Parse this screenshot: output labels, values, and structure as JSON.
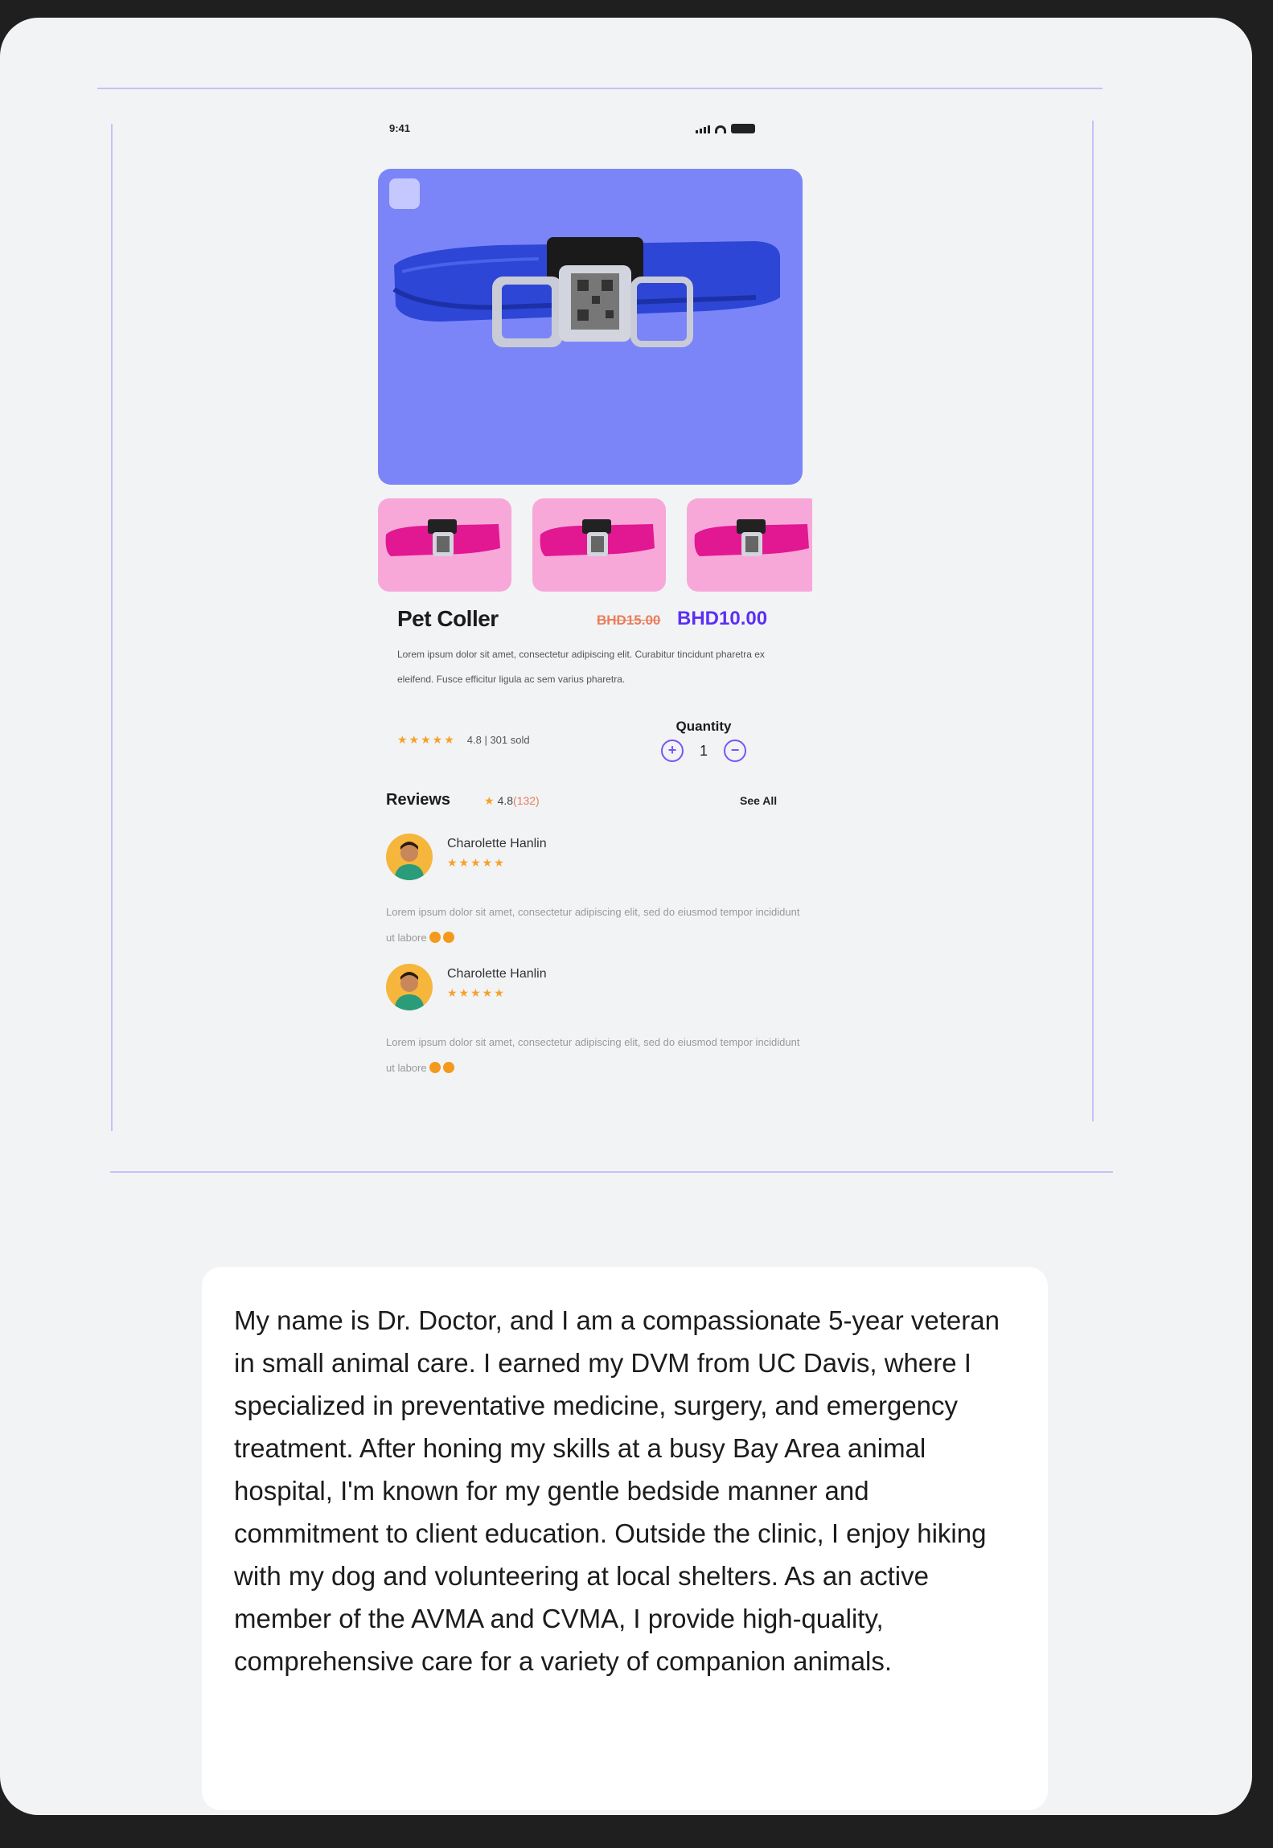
{
  "status_bar": {
    "time": "9:41"
  },
  "product": {
    "title": "Pet Coller",
    "price_old": "BHD15.00",
    "price_new": "BHD10.00",
    "description": "Lorem ipsum dolor sit amet, consectetur adipiscing elit. Curabitur tincidunt pharetra ex eleifend. Fusce efficitur ligula ac sem varius pharetra.",
    "stars": "★★★★★",
    "rating_meta": "4.8 | 301 sold",
    "colors": {
      "hero_bg": "#7b85f8",
      "thumb_bg": "#f7a8d9",
      "accent": "#5b2ff5",
      "old_price": "#ea7d5c"
    }
  },
  "quantity": {
    "label": "Quantity",
    "increase_symbol": "+",
    "value": "1",
    "decrease_symbol": "−"
  },
  "reviews": {
    "heading": "Reviews",
    "rating_star": "★",
    "rating": "4.8",
    "count": "(132)",
    "see_all": "See All",
    "items": [
      {
        "name": "Charolette Hanlin",
        "stars": "★★★★★",
        "text": "Lorem ipsum dolor sit amet, consectetur adipiscing elit, sed do eiusmod tempor incididunt ut labore"
      },
      {
        "name": "Charolette Hanlin",
        "stars": "★★★★★",
        "text": "Lorem ipsum dolor sit amet, consectetur adipiscing elit, sed do eiusmod tempor incididunt ut labore"
      }
    ]
  },
  "bio": {
    "text": "My name is Dr. Doctor, and I am a compassionate 5-year veteran in small animal care. I earned my DVM from UC Davis, where I specialized in preventative medicine, surgery, and emergency treatment. After honing my skills at a busy Bay Area animal hospital, I'm known for my gentle bedside manner and commitment to client education. Outside the clinic, I enjoy hiking with my dog and volunteering at local shelters. As an active member of the AVMA and CVMA, I provide high-quality, comprehensive care for a variety of companion animals."
  }
}
